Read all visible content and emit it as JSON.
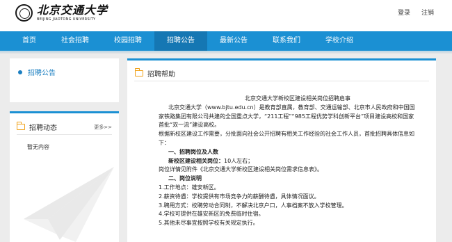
{
  "header": {
    "logo_cn": "北京交通大学",
    "logo_en": "BEIJING JIAOTONG UNIVERSITY",
    "login": "登录",
    "logout": "注销"
  },
  "nav": {
    "items": [
      "首页",
      "社会招聘",
      "校园招聘",
      "招聘公告",
      "最新公告",
      "联系我们",
      "学校介绍"
    ],
    "active_index": 3
  },
  "sidebar": {
    "current": "招聘公告",
    "news_title": "招聘动态",
    "more": "更多>>",
    "empty": "暂无内容"
  },
  "main": {
    "section_title": "招聘帮助",
    "article_title": "北京交通大学新校区建设相关岗位招聘启事",
    "para1": "北京交通大学（www.bjtu.edu.cn）是教育部直属，教育部、交通运输部、北京市人民政府和中国国家铁路集团有限公司共建的全国重点大学，“211工程”“985工程优势学科创新平台”项目建设高校和国家首批“双一流”建设高校。",
    "para2": "根据新校区建设工作需要，分批面向社会公开招聘有相关工作经验的社会工作人员，首批招聘具体信息如下：",
    "h1": "一、招聘岗位及人数",
    "h1_label": "新校区建设相关岗位：",
    "h1_value": "10人左右；",
    "h1_detail": "岗位详情见附件《北京交通大学新校区建设相关岗位需求信息表》。",
    "h2": "二、岗位说明",
    "items": [
      "1.工作地点：雄安新区。",
      "2.薪资待遇：学校提供有市场竞争力的薪酬待遇，具体情况面议。",
      "3.聘用方式：校聘劳动合同制，不解决北京户口，人事档案不放入学校管理。",
      "4.学校可提供在雄安新区的免费临时住宿。",
      "5.其他未尽事宜按照学校有关规定执行。"
    ]
  },
  "colors": {
    "nav_bg": "#1b90d3",
    "nav_active": "#1577b3",
    "accent_text": "#1b7fc1",
    "folder_icon": "#f0a21a"
  }
}
